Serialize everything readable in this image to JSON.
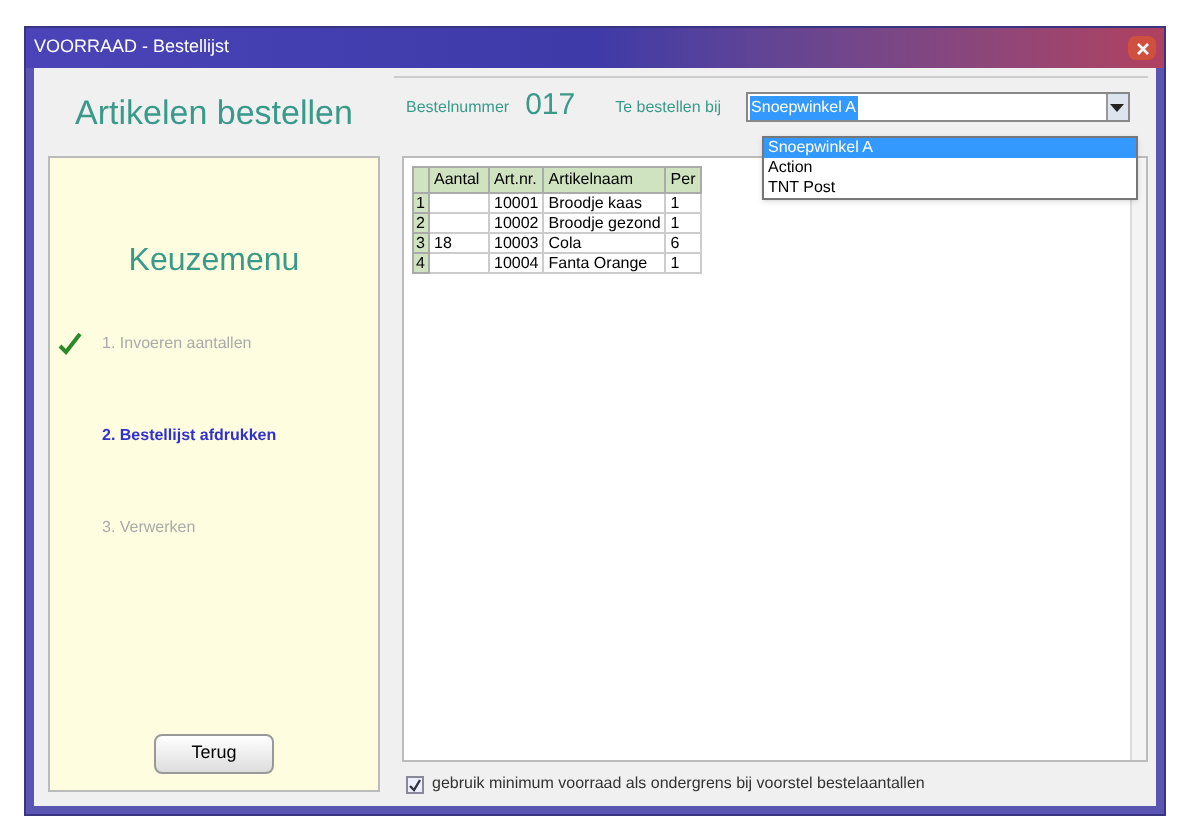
{
  "window": {
    "title": "VOORRAAD - Bestellijst"
  },
  "sidebar": {
    "title": "Artikelen bestellen",
    "menu_title": "Keuzemenu",
    "steps": [
      {
        "label": "1. Invoeren aantallen",
        "done": true,
        "selected": false
      },
      {
        "label": "2. Bestellijst afdrukken",
        "done": false,
        "selected": true
      },
      {
        "label": "3. Verwerken",
        "done": false,
        "selected": false
      }
    ],
    "back_button": "Terug"
  },
  "order": {
    "number_label": "Bestelnummer",
    "number": "017",
    "supplier_label": "Te bestellen bij",
    "supplier": "Snoepwinkel A",
    "dropdown_options": [
      {
        "label": "Snoepwinkel A",
        "selected": true
      },
      {
        "label": "Action",
        "selected": false
      },
      {
        "label": "TNT Post",
        "selected": false
      }
    ]
  },
  "table": {
    "columns": [
      "Aantal",
      "Art.nr.",
      "Artikelnaam",
      "Per"
    ],
    "rows": [
      {
        "index": "1",
        "cells": [
          "",
          "10001",
          "Broodje kaas",
          "1"
        ]
      },
      {
        "index": "2",
        "cells": [
          "",
          "10002",
          "Broodje gezond",
          "1"
        ]
      },
      {
        "index": "3",
        "cells": [
          "18",
          "10003",
          "Cola",
          "6"
        ]
      },
      {
        "index": "4",
        "cells": [
          "",
          "10004",
          "Fanta Orange",
          "1"
        ]
      }
    ]
  },
  "option": {
    "label": "gebruik minimum voorraad als ondergrens bij voorstel bestelaantallen",
    "checked": true
  }
}
